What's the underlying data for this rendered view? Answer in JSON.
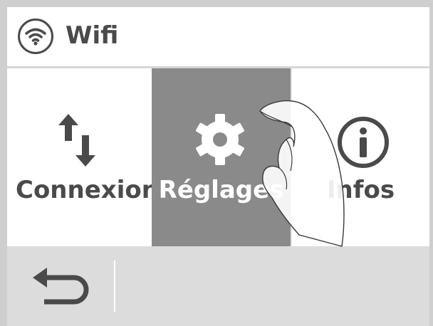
{
  "header": {
    "title": "Wifi",
    "icon": "wifi-icon"
  },
  "tiles": [
    {
      "label": "Connexion",
      "icon": "transfer-arrows-icon",
      "selected": false
    },
    {
      "label": "Réglages",
      "icon": "gear-icon",
      "selected": true
    },
    {
      "label": "Infos",
      "icon": "info-icon",
      "selected": false
    }
  ],
  "footer": {
    "back_icon": "back-arrow-icon"
  },
  "overlay": {
    "icon": "pointing-hand-icon"
  },
  "colors": {
    "selected_tile": "#8a8a8a",
    "text": "#4a4a4a",
    "footer": "#dcdcdc"
  }
}
